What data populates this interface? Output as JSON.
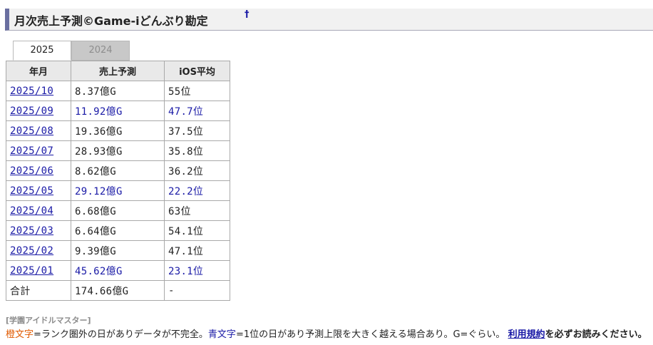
{
  "heading": {
    "title": "月次売上予測©Game-iどんぶり勘定",
    "anchor": "†"
  },
  "tabs": [
    {
      "label": "2025",
      "active": true
    },
    {
      "label": "2024",
      "active": false
    }
  ],
  "table": {
    "headers": [
      "年月",
      "売上予測",
      "iOS平均"
    ],
    "rows": [
      {
        "month": "2025/10",
        "sales": "8.37億G",
        "ios": "55位",
        "blue": false
      },
      {
        "month": "2025/09",
        "sales": "11.92億G",
        "ios": "47.7位",
        "blue": true
      },
      {
        "month": "2025/08",
        "sales": "19.36億G",
        "ios": "37.5位",
        "blue": false
      },
      {
        "month": "2025/07",
        "sales": "28.93億G",
        "ios": "35.8位",
        "blue": false
      },
      {
        "month": "2025/06",
        "sales": "8.62億G",
        "ios": "36.2位",
        "blue": false
      },
      {
        "month": "2025/05",
        "sales": "29.12億G",
        "ios": "22.2位",
        "blue": true
      },
      {
        "month": "2025/04",
        "sales": "6.68億G",
        "ios": "63位",
        "blue": false
      },
      {
        "month": "2025/03",
        "sales": "6.64億G",
        "ios": "54.1位",
        "blue": false
      },
      {
        "month": "2025/02",
        "sales": "9.39億G",
        "ios": "47.1位",
        "blue": false
      },
      {
        "month": "2025/01",
        "sales": "45.62億G",
        "ios": "23.1位",
        "blue": true
      }
    ],
    "total": {
      "label": "合計",
      "sales": "174.66億G",
      "ios": "-"
    }
  },
  "notes": {
    "game": "[学園アイドルマスター]",
    "orange_term": "橙文字",
    "orange_desc": "=ランク圏外の日がありデータが不完全。",
    "blue_term": "青文字",
    "blue_desc": "=1位の日があり予測上限を大きく越える場合あり。G=ぐらい。",
    "terms_link": "利用規約",
    "terms_suffix": "を必ずお読みください。"
  },
  "colors": {
    "link": "#1a1aa6",
    "orange": "#e05a00",
    "header_bar": "#6a6fa0"
  }
}
